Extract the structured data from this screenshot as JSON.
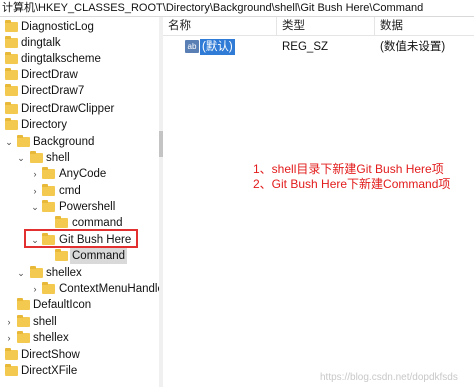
{
  "address_bar": {
    "path": "计算机\\HKEY_CLASSES_ROOT\\Directory\\Background\\shell\\Git Bush Here\\Command"
  },
  "tree": {
    "items": [
      {
        "label": "DiagnosticLog",
        "expanded": false
      },
      {
        "label": "dingtalk",
        "expanded": false
      },
      {
        "label": "dingtalkscheme",
        "expanded": false
      },
      {
        "label": "DirectDraw",
        "expanded": false
      },
      {
        "label": "DirectDraw7",
        "expanded": false
      },
      {
        "label": "DirectDrawClipper",
        "expanded": false
      },
      {
        "label": "Directory",
        "expanded": true
      },
      {
        "label": "Background",
        "expanded": true
      },
      {
        "label": "shell",
        "expanded": true
      },
      {
        "label": "AnyCode",
        "expanded": false
      },
      {
        "label": "cmd",
        "expanded": false
      },
      {
        "label": "Powershell",
        "expanded": true
      },
      {
        "label": "command",
        "expanded": false
      },
      {
        "label": "Git Bush Here",
        "expanded": true
      },
      {
        "label": "Command",
        "expanded": false,
        "selected": true
      },
      {
        "label": "shellex",
        "expanded": true
      },
      {
        "label": "ContextMenuHandler",
        "expanded": false
      },
      {
        "label": "DefaultIcon",
        "expanded": false
      },
      {
        "label": "shell",
        "expanded": false
      },
      {
        "label": "shellex",
        "expanded": false
      },
      {
        "label": "DirectShow",
        "expanded": false
      },
      {
        "label": "DirectXFile",
        "expanded": false
      }
    ]
  },
  "list_view": {
    "columns": [
      "名称",
      "类型",
      "数据"
    ],
    "rows": [
      {
        "icon_text": "ab",
        "name": "(默认)",
        "type": "REG_SZ",
        "data": "(数值未设置)"
      }
    ]
  },
  "annotation": {
    "line1": "1、shell目录下新建Git Bush Here项",
    "line2": "2、Git Bush Here下新建Command项",
    "color": "#e21b1b"
  },
  "watermark": "https://blog.csdn.net/dopdkfsds",
  "colors": {
    "highlight_border": "#e23030",
    "selection": "#2f7bd6",
    "folder": "#f3c94f"
  }
}
